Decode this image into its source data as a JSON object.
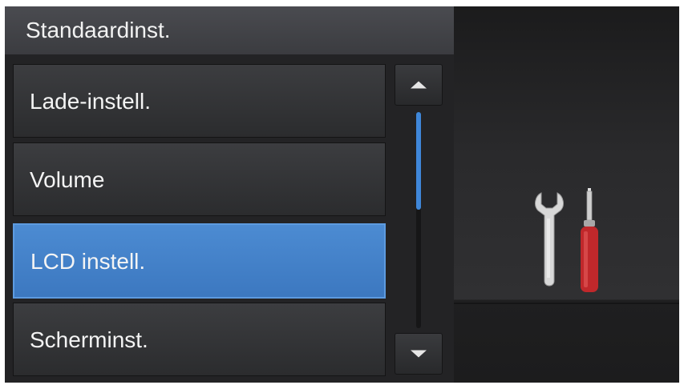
{
  "header": {
    "title": "Standaardinst."
  },
  "menu": {
    "items": [
      {
        "label": "Lade-instell.",
        "selected": false
      },
      {
        "label": "Volume",
        "selected": false
      },
      {
        "label": "LCD instell.",
        "selected": true
      },
      {
        "label": "Scherminst.",
        "selected": false
      }
    ]
  },
  "scrollbar": {
    "up_icon": "triangle-up",
    "down_icon": "triangle-down",
    "position_fraction": 0,
    "visible_fraction": 0.45
  },
  "side_panel": {
    "icon": "wrench-and-screwdriver"
  },
  "colors": {
    "selection": "#4282cc",
    "scroll_thumb": "#3f87d9",
    "screwdriver_handle": "#c0282b"
  }
}
